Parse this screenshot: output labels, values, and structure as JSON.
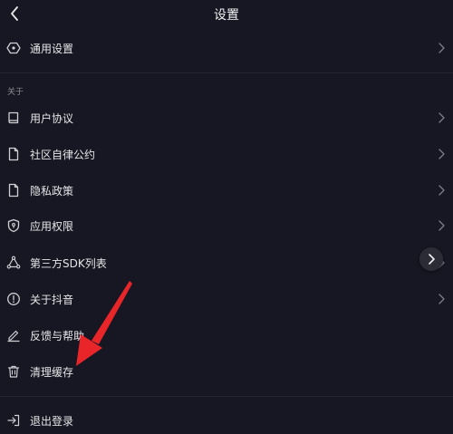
{
  "header": {
    "title": "设置"
  },
  "general": {
    "label": "通用设置"
  },
  "about_section": {
    "title": "关于",
    "items": [
      {
        "label": "用户协议",
        "icon": "book-icon"
      },
      {
        "label": "社区自律公约",
        "icon": "document-icon"
      },
      {
        "label": "隐私政策",
        "icon": "document-icon"
      },
      {
        "label": "应用权限",
        "icon": "shield-icon"
      },
      {
        "label": "第三方SDK列表",
        "icon": "share-triangle-icon"
      },
      {
        "label": "关于抖音",
        "icon": "info-circle-icon"
      },
      {
        "label": "反馈与帮助",
        "icon": "pencil-icon"
      },
      {
        "label": "清理缓存",
        "icon": "trash-icon"
      }
    ]
  },
  "logout": {
    "label": "退出登录",
    "icon": "logout-icon"
  },
  "colors": {
    "background": "#161722",
    "text": "#e6e6e8",
    "annotation_arrow": "#e8262a"
  }
}
